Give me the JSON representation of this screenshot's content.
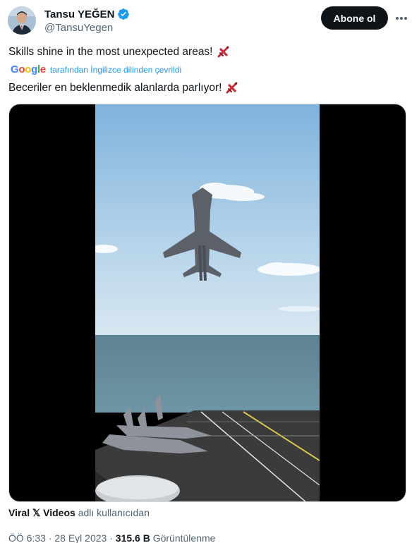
{
  "author": {
    "name": "Tansu YEĞEN",
    "handle": "@TansuYegen",
    "verified": true,
    "avatar_icon": "person-avatar"
  },
  "follow_button": {
    "label": "Abone ol"
  },
  "tweet": {
    "text_original": "Skills shine in the most unexpected areas!",
    "text_translated": "Beceriler en beklenmedik alanlarda parlıyor!",
    "emoji": "airplane-emoji"
  },
  "translation": {
    "provider": "Google",
    "note": "tarafından İngilizce dilinden çevrildi"
  },
  "media": {
    "type": "video",
    "description_icon": "fighter-jet-over-carrier"
  },
  "attribution": {
    "source": "Viral 𝕏 Videos",
    "suffix": "adlı kullanıcıdan"
  },
  "meta": {
    "time": "ÖÖ 6:33",
    "separator": "·",
    "date": "28 Eyl 2023",
    "views_count": "315.6 B",
    "views_label": "Görüntülenme"
  },
  "colors": {
    "primary_text": "#0f1419",
    "secondary_text": "#536471",
    "link": "#1d9bf0",
    "verified": "#1d9bf0",
    "follow_bg": "#0f1419"
  }
}
